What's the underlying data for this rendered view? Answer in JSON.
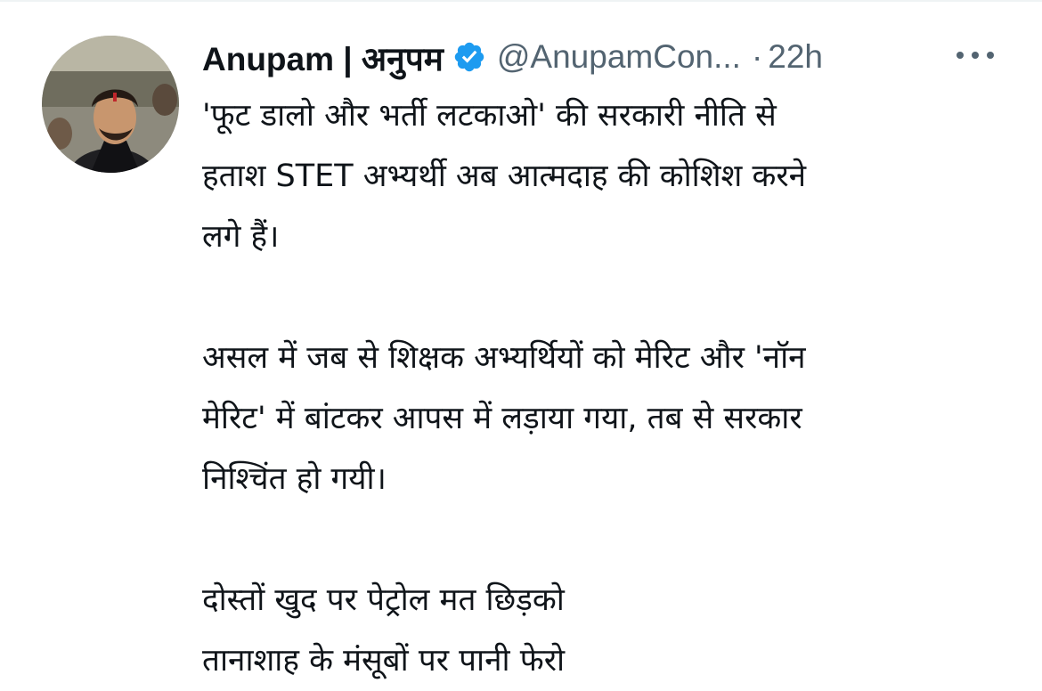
{
  "author": {
    "display_name": "Anupam | अनुपम",
    "handle": "@AnupamCon...",
    "separator": "·",
    "timestamp": "22h",
    "verified": true,
    "verified_color": "#1d9bf0"
  },
  "tweet": {
    "paragraphs": [
      [
        "'फूट डालो और भर्ती लटकाओ' की सरकारी नीति से",
        "हताश STET अभ्यर्थी अब आत्मदाह की कोशिश करने",
        "लगे हैं।"
      ],
      [
        "असल में जब से शिक्षक अभ्यर्थियों को मेरिट और 'नॉन",
        "मेरिट' में बांटकर आपस में लड़ाया गया, तब से सरकार",
        "निश्चिंत हो गयी।"
      ],
      [
        "दोस्तों खुद पर पेट्रोल मत छिड़को",
        "तानाशाह के मंसूबों पर पानी फेरो"
      ]
    ]
  },
  "icons": {
    "avatar": "profile-photo",
    "verified": "verified-badge-icon",
    "more": "more-options-icon"
  },
  "colors": {
    "text_primary": "#0f1419",
    "text_secondary": "#536471",
    "accent": "#1d9bf0"
  }
}
